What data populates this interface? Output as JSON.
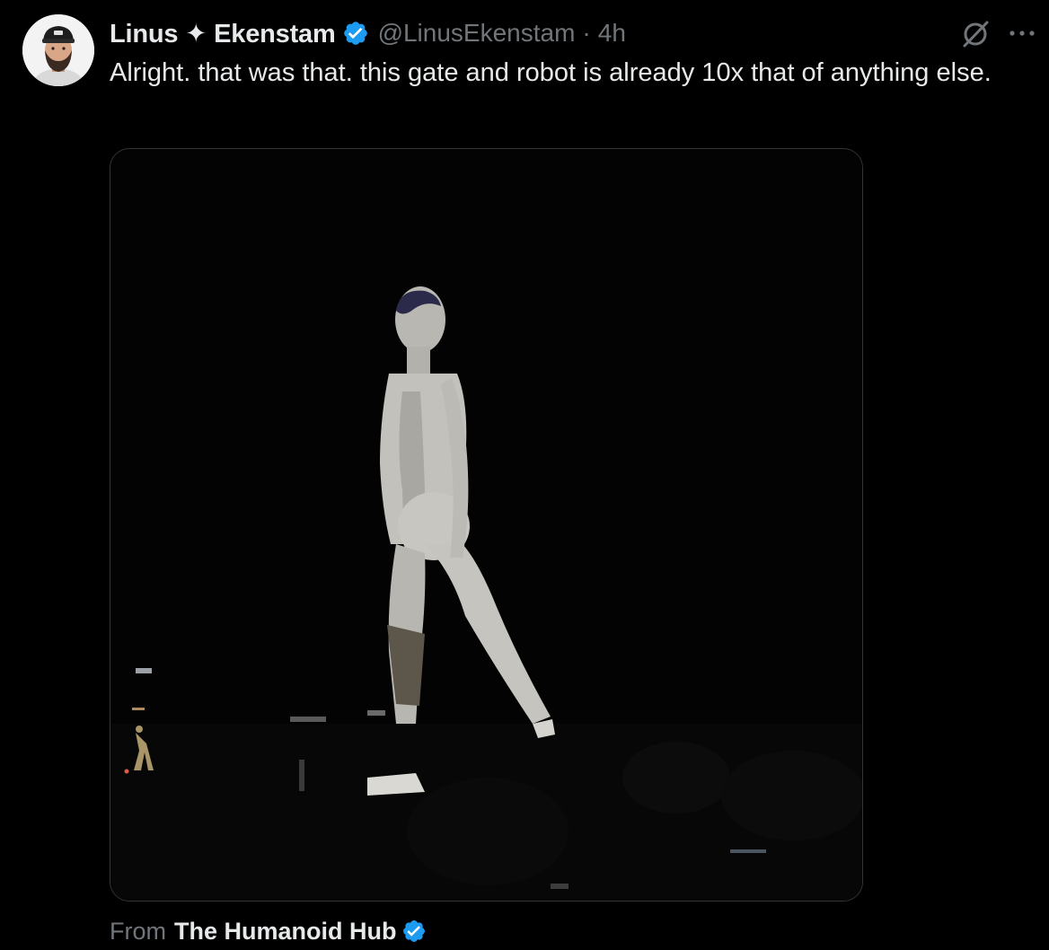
{
  "tweet": {
    "author": {
      "display_name": "Linus ✦ Ekenstam",
      "handle": "@LinusEkenstam",
      "verified": true
    },
    "separator": "·",
    "timestamp": "4h",
    "text": "Alright. that was that. this gate and robot is already 10x that of anything else.",
    "media": {
      "icon": "video-thumbnail"
    },
    "source": {
      "prefix": "From",
      "name": "The Humanoid Hub",
      "verified": true
    }
  },
  "icons": {
    "grok": "grok-icon",
    "more": "more-options-icon",
    "verified": "verified-badge-icon"
  },
  "colors": {
    "background": "#000000",
    "text_primary": "#e7e9ea",
    "text_secondary": "#71767b",
    "verified_blue": "#1d9bf0",
    "border": "#333639"
  }
}
